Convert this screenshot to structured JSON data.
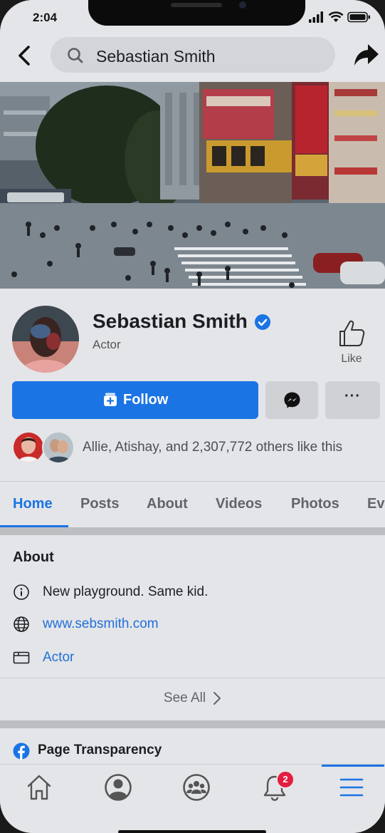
{
  "status": {
    "time": "2:04"
  },
  "search": {
    "query": "Sebastian Smith"
  },
  "profile": {
    "name": "Sebastian Smith",
    "category": "Actor",
    "like_label": "Like",
    "follow_label": "Follow",
    "more_label": "···",
    "likes_text": "Allie, Atishay, and 2,307,772 others like this"
  },
  "tabs": [
    {
      "label": "Home",
      "active": true
    },
    {
      "label": "Posts"
    },
    {
      "label": "About"
    },
    {
      "label": "Videos"
    },
    {
      "label": "Photos"
    },
    {
      "label": "Ev"
    }
  ],
  "about": {
    "title": "About",
    "bio": "New playground. Same kid.",
    "website": "www.sebsmith.com",
    "category": "Actor",
    "see_all": "See All"
  },
  "transparency": {
    "title": "Page Transparency"
  },
  "nav": {
    "notifications_badge": "2"
  },
  "colors": {
    "accent": "#1b74e4",
    "badge": "#e41e3f",
    "background": "#e4e5e8"
  },
  "icons": [
    "back-icon",
    "search-icon",
    "share-icon",
    "verified-icon",
    "like-icon",
    "follow-icon",
    "messenger-icon",
    "info-icon",
    "globe-icon",
    "category-icon",
    "chevron-right-icon",
    "facebook-icon",
    "home-icon",
    "profile-icon",
    "groups-icon",
    "bell-icon",
    "menu-icon"
  ]
}
